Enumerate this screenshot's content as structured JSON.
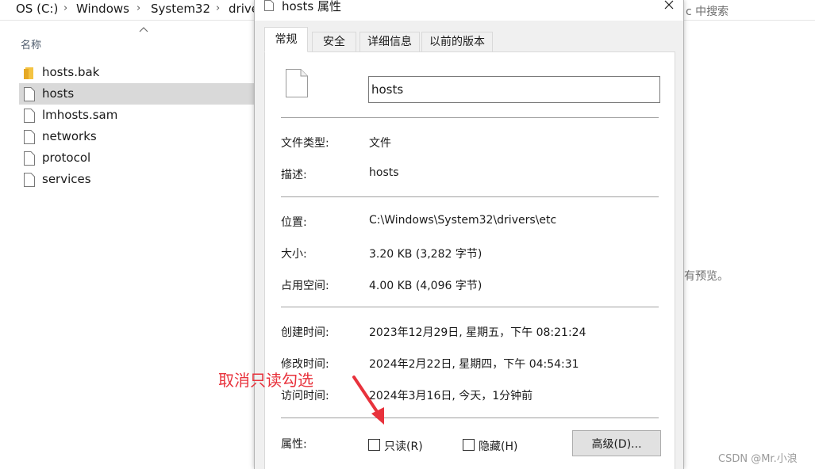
{
  "explorer": {
    "breadcrumbs": [
      "OS (C:)",
      "Windows",
      "System32",
      "drive"
    ],
    "search_placeholder": "c 中搜索",
    "column_name": "名称",
    "files": [
      {
        "name": "hosts.bak",
        "icon": "folder-icon"
      },
      {
        "name": "hosts",
        "icon": "file-icon",
        "selected": true
      },
      {
        "name": "lmhosts.sam",
        "icon": "file-icon"
      },
      {
        "name": "networks",
        "icon": "file-icon"
      },
      {
        "name": "protocol",
        "icon": "file-icon"
      },
      {
        "name": "services",
        "icon": "file-icon"
      }
    ],
    "preview_text": "有预览。",
    "watermark": "CSDN @Mr.小浪"
  },
  "dialog": {
    "title": "hosts 属性",
    "tabs": [
      {
        "label": "常规",
        "active": true
      },
      {
        "label": "安全"
      },
      {
        "label": "详细信息"
      },
      {
        "label": "以前的版本"
      }
    ],
    "filename": "hosts",
    "props": {
      "type_label": "文件类型:",
      "type_value": "文件",
      "desc_label": "描述:",
      "desc_value": "hosts",
      "location_label": "位置:",
      "location_value": "C:\\Windows\\System32\\drivers\\etc",
      "size_label": "大小:",
      "size_value": "3.20 KB (3,282 字节)",
      "disk_label": "占用空间:",
      "disk_value": "4.00 KB (4,096 字节)",
      "created_label": "创建时间:",
      "created_value": "2023年12月29日, 星期五，下午 08:21:24",
      "modified_label": "修改时间:",
      "modified_value": "2024年2月22日, 星期四，下午 04:54:31",
      "accessed_label": "访问时间:",
      "accessed_value": "2024年3月16日, 今天，1分钟前"
    },
    "attributes_label": "属性:",
    "readonly_label": "只读(R)",
    "hidden_label": "隐藏(H)",
    "advanced_label": "高级(D)..."
  },
  "annotation": {
    "text": "取消只读勾选",
    "color": "#e8323c"
  }
}
